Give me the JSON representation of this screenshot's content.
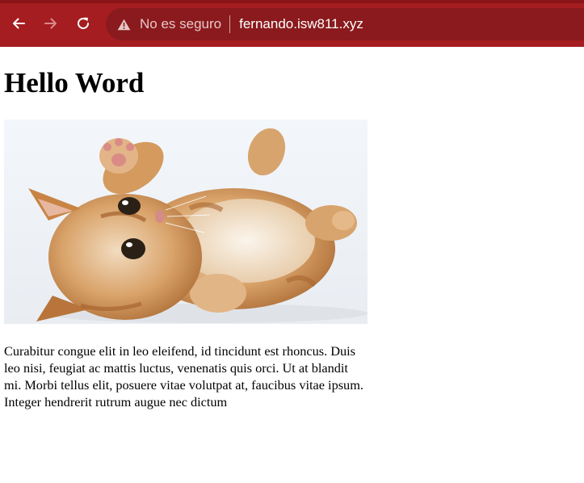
{
  "browser": {
    "security_label": "No es seguro",
    "url": "fernando.isw811.xyz",
    "toolbar_color": "#a51d20",
    "omnibox_color": "#8a1a1d",
    "icons": [
      "back-arrow-icon",
      "forward-arrow-icon",
      "reload-icon",
      "warning-triangle-icon"
    ]
  },
  "page": {
    "title": "Hello Word",
    "image_alt": "kitten",
    "paragraph": "Curabitur congue elit in leo eleifend, id tincidunt est rhoncus. Duis leo nisi, feugiat ac mattis luctus, venenatis quis orci. Ut at blandit mi. Morbi tellus elit, posuere vitae volutpat at, faucibus vitae ipsum. Integer hendrerit rutrum augue nec dictum"
  }
}
